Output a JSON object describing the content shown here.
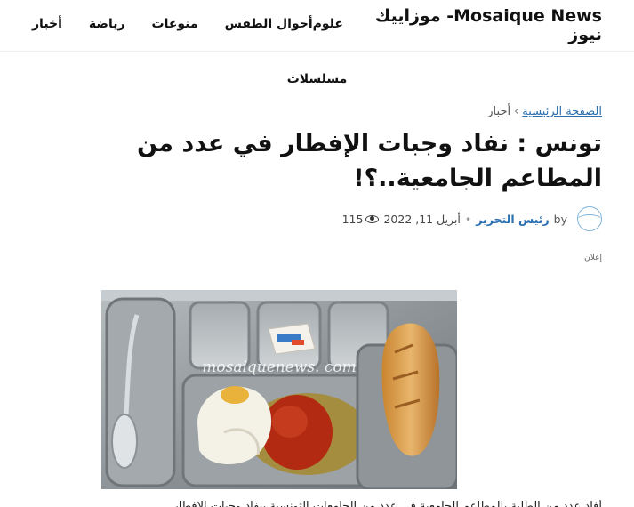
{
  "site": {
    "title": "Mosaique News- موزاييك نيوز"
  },
  "nav": {
    "items": [
      "أخبار",
      "رياضة",
      "منوعات",
      "أحوال الطقس",
      "علوم"
    ]
  },
  "subnav": {
    "item": "مسلسلات"
  },
  "breadcrumb": {
    "home": "الصفحة الرئيسية",
    "separator": "›",
    "section": "أخبار"
  },
  "article": {
    "title": "تونس : نفاد وجبات الإفطار في عدد من المطاعم الجامعية..؟!",
    "by": "by",
    "author": "رئيس التحرير",
    "date": "أبريل 11, 2022",
    "views": "115",
    "ad_label": "إعلان",
    "photo_watermark": "mosaiquenews. com",
    "body_start": "أفاد عدد من الطلبة بالمطاعم الجامعية في عدد من الجامعات التونسية بنفاد وجبات الإفطار"
  },
  "colors": {
    "link": "#2a6fb0",
    "text": "#111111",
    "avatar_ring": "#7fb3d9"
  }
}
